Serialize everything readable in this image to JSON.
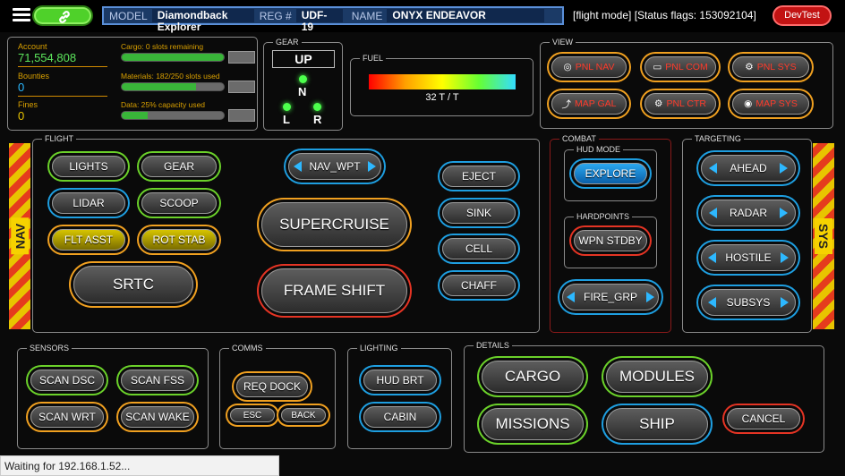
{
  "topbar": {
    "model_label": "MODEL",
    "model_value": "Diamondback Explorer",
    "reg_label": "REG #",
    "reg_value": "UDF-19",
    "name_label": "NAME",
    "name_value": "ONYX ENDEAVOR",
    "flags_text": "[flight mode] [Status flags: 153092104]",
    "devtest_label": "DevTest"
  },
  "stats": {
    "account_label": "Account",
    "account_value": "71,554,808",
    "bounties_label": "Bounties",
    "bounties_value": "0",
    "fines_label": "Fines",
    "fines_value": "0"
  },
  "cargo": {
    "cargo_label": "Cargo: 0 slots remaining",
    "cargo_fill": 1.0,
    "materials_label": "Materials: 182/250 slots used",
    "materials_fill": 0.728,
    "data_label": "Data: 25% capacity used",
    "data_fill": 0.25
  },
  "gear": {
    "title": "GEAR",
    "state": "UP",
    "n": "N",
    "l": "L",
    "r": "R"
  },
  "fuel": {
    "title": "FUEL",
    "readout": "32 T / T"
  },
  "view": {
    "title": "VIEW",
    "buttons": [
      "PNL NAV",
      "PNL COM",
      "PNL SYS",
      "MAP GAL",
      "PNL CTR",
      "MAP SYS"
    ]
  },
  "flight": {
    "title": "FLIGHT",
    "lights": "LIGHTS",
    "gear": "GEAR",
    "lidar": "LIDAR",
    "scoop": "SCOOP",
    "flt_asst": "FLT ASST",
    "rot_stab": "ROT STAB",
    "srtc": "SRTC",
    "nav_wpt": "NAV_WPT",
    "supercruise": "SUPERCRUISE",
    "frame_shift": "FRAME SHIFT",
    "eject": "EJECT",
    "sink": "SINK",
    "cell": "CELL",
    "chaff": "CHAFF"
  },
  "combat": {
    "title": "COMBAT",
    "hud_mode_title": "HUD MODE",
    "explore": "EXPLORE",
    "hardpoints_title": "HARDPOINTS",
    "wpn_stdby": "WPN STDBY",
    "fire_grp": "FIRE_GRP"
  },
  "targeting": {
    "title": "TARGETING",
    "ahead": "AHEAD",
    "radar": "RADAR",
    "hostile": "HOSTILE",
    "subsys": "SUBSYS"
  },
  "side": {
    "nav": "NAV",
    "sys": "SYS"
  },
  "sensors": {
    "title": "SENSORS",
    "scan_dsc": "SCAN DSC",
    "scan_fss": "SCAN FSS",
    "scan_wrt": "SCAN WRT",
    "scan_wake": "SCAN WAKE"
  },
  "comms": {
    "title": "COMMS",
    "req_dock": "REQ DOCK",
    "esc": "ESC",
    "back": "BACK"
  },
  "lighting": {
    "title": "LIGHTING",
    "hud_brt": "HUD BRT",
    "cabin": "CABIN"
  },
  "details": {
    "title": "DETAILS",
    "cargo": "CARGO",
    "modules": "MODULES",
    "missions": "MISSIONS",
    "ship": "SHIP",
    "cancel": "CANCEL"
  },
  "statusbar": {
    "text": "Waiting for 192.168.1.52..."
  }
}
